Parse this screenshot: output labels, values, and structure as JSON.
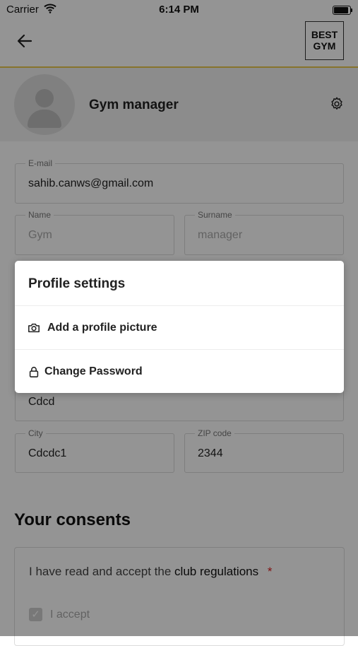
{
  "status_bar": {
    "carrier": "Carrier",
    "time": "6:14 PM"
  },
  "header": {
    "logo_line1": "BEST",
    "logo_line2": "GYM"
  },
  "profile": {
    "name": "Gym manager"
  },
  "form": {
    "email": {
      "label": "E-mail",
      "value": "sahib.canws@gmail.com"
    },
    "name": {
      "label": "Name",
      "value": "Gym"
    },
    "surname": {
      "label": "Surname",
      "value": "manager"
    },
    "street": {
      "value": "Cdcd"
    },
    "city": {
      "label": "City",
      "value": "Cdcdc1"
    },
    "zip": {
      "label": "ZIP code",
      "value": "2344"
    }
  },
  "consents": {
    "title": "Your consents",
    "text_prefix": "I have read and accept the",
    "text_strong": "club regulations",
    "required_mark": "*",
    "checkbox_label": "I accept"
  },
  "profile_settings": {
    "title": "Profile settings",
    "items": [
      {
        "label": "Add a profile picture",
        "icon": "camera-icon"
      },
      {
        "label": "Change Password",
        "icon": "lock-icon"
      }
    ]
  }
}
